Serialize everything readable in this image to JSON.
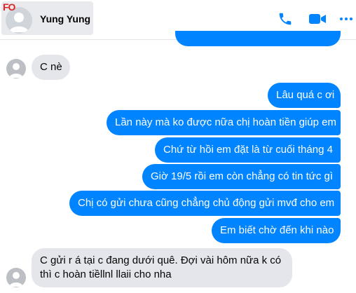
{
  "header": {
    "watermark": "FO",
    "contact_name": "Yung Yung",
    "icons": [
      "phone-icon",
      "video-camera-icon",
      "more-options-icon"
    ],
    "accent_color": "#0084ff"
  },
  "messages": [
    {
      "direction": "incoming",
      "text": "C nè"
    },
    {
      "direction": "outgoing",
      "text": "Lâu quá c ơi"
    },
    {
      "direction": "outgoing",
      "text": "Lần này mà ko được nữa chị hoàn tiền giúp em"
    },
    {
      "direction": "outgoing",
      "text": "Chứ từ hồi em đặt là từ cuối tháng 4"
    },
    {
      "direction": "outgoing",
      "text": "Giờ 19/5 rồi em còn chẳng có tin tức gì"
    },
    {
      "direction": "outgoing",
      "text": "Chị có gửi chưa cũng chẳng chủ động gửi mvđ cho em"
    },
    {
      "direction": "outgoing",
      "text": "Em biết chờ đến khi nào"
    },
    {
      "direction": "incoming",
      "text": "C gửi r á tại c đang dưới quê. Đợi vài hôm nữa k có thì c hoàn tiềllnl llaii cho nha"
    }
  ]
}
